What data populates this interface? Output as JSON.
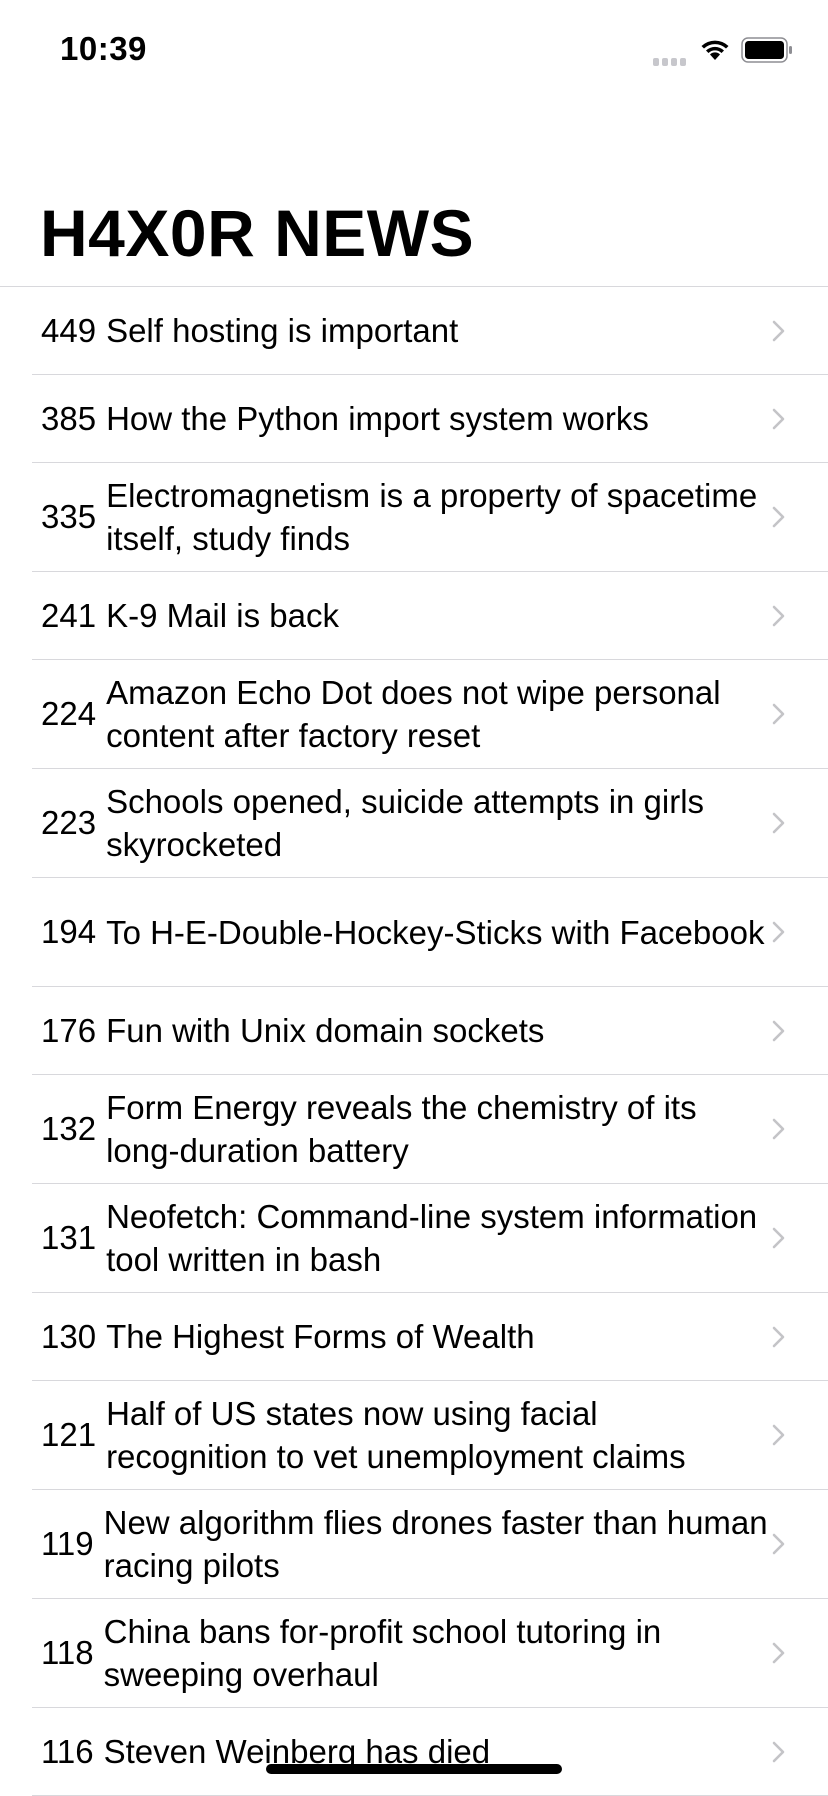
{
  "status_bar": {
    "time": "10:39",
    "icons": [
      "signal-icon",
      "wifi-icon",
      "battery-icon"
    ]
  },
  "nav": {
    "title": "H4X0R NEWS"
  },
  "stories": [
    {
      "points": "449",
      "title": "Self hosting is important"
    },
    {
      "points": "385",
      "title": "How the Python import system works"
    },
    {
      "points": "335",
      "title": "Electromagnetism is a property of spacetime itself, study finds"
    },
    {
      "points": "241",
      "title": "K-9 Mail is back"
    },
    {
      "points": "224",
      "title": "Amazon Echo Dot does not wipe personal content after factory reset"
    },
    {
      "points": "223",
      "title": "Schools opened, suicide attempts in girls skyrocketed"
    },
    {
      "points": "194",
      "title": "To H-E-Double-Hockey-Sticks with Facebook"
    },
    {
      "points": "176",
      "title": "Fun with Unix domain sockets"
    },
    {
      "points": "132",
      "title": "Form Energy reveals the chemistry of its long-duration battery"
    },
    {
      "points": "131",
      "title": "Neofetch: Command-line system information tool written in bash"
    },
    {
      "points": "130",
      "title": "The Highest Forms of Wealth"
    },
    {
      "points": "121",
      "title": "Half of US states now using facial recognition to vet unemployment claims"
    },
    {
      "points": "119",
      "title": "New algorithm flies drones faster than human racing pilots"
    },
    {
      "points": "118",
      "title": "China bans for-profit school tutoring in sweeping overhaul"
    },
    {
      "points": "116",
      "title": "Steven Weinberg has died"
    }
  ],
  "colors": {
    "separator": "#d8d8dc",
    "chevron": "#c4c4c7",
    "signal_inactive": "#c7c7cc"
  }
}
